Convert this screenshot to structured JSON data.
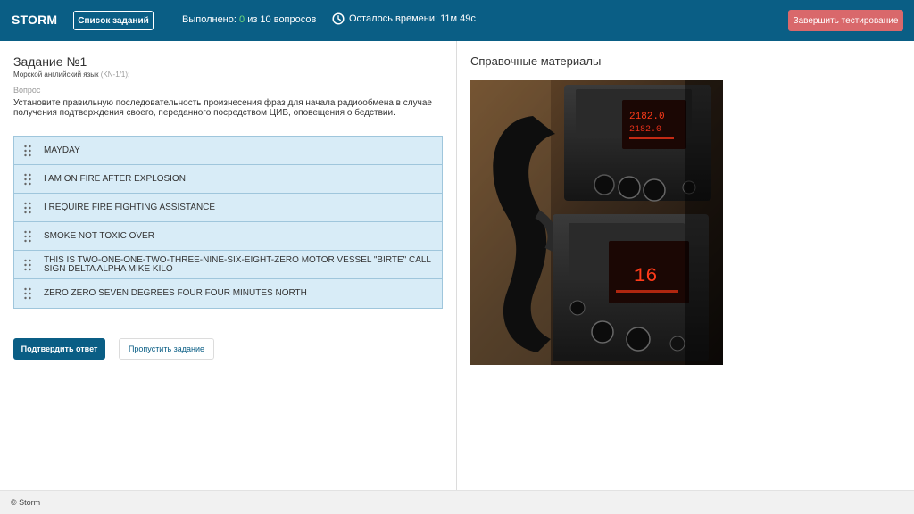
{
  "header": {
    "brand": "STORM",
    "tasks_button": "Список заданий",
    "progress_label": "Выполнено:",
    "progress_done": "0",
    "progress_rest": "из 10 вопросов",
    "timer_label": "Осталось времени: 11м 49с",
    "finish_button": "Завершить тестирование",
    "accent_color": "#0a5e85",
    "finish_color": "#d9686b"
  },
  "task": {
    "title": "Задание №1",
    "subject": "Морской английский язык",
    "subject_code": "(KN-1/1);",
    "question_label": "Вопрос",
    "question_text": "Установите правильную последовательность произнесения фраз для начала радиообмена в случае получения подтверждения своего, переданного посредством ЦИВ, оповещения о бедствии.",
    "items": [
      "MAYDAY",
      "I AM ON FIRE AFTER EXPLOSION",
      "I REQUIRE FIRE FIGHTING ASSISTANCE",
      "SMOKE NOT TOXIC OVER",
      "THIS IS TWO-ONE-ONE-TWO-THREE-NINE-SIX-EIGHT-ZERO MOTOR VESSEL \"BIRTE\" CALL SIGN DELTA ALPHA MIKE KILO",
      "ZERO ZERO SEVEN DEGREES FOUR FOUR MINUTES NORTH"
    ],
    "confirm_button": "Подтвердить ответ",
    "skip_button": "Пропустить задание"
  },
  "reference": {
    "title": "Справочные материалы",
    "image_text_top": "2182.0",
    "image_text_top2": "2182.0",
    "image_text_bottom": "16"
  },
  "footer": {
    "copyright": "© Storm"
  }
}
